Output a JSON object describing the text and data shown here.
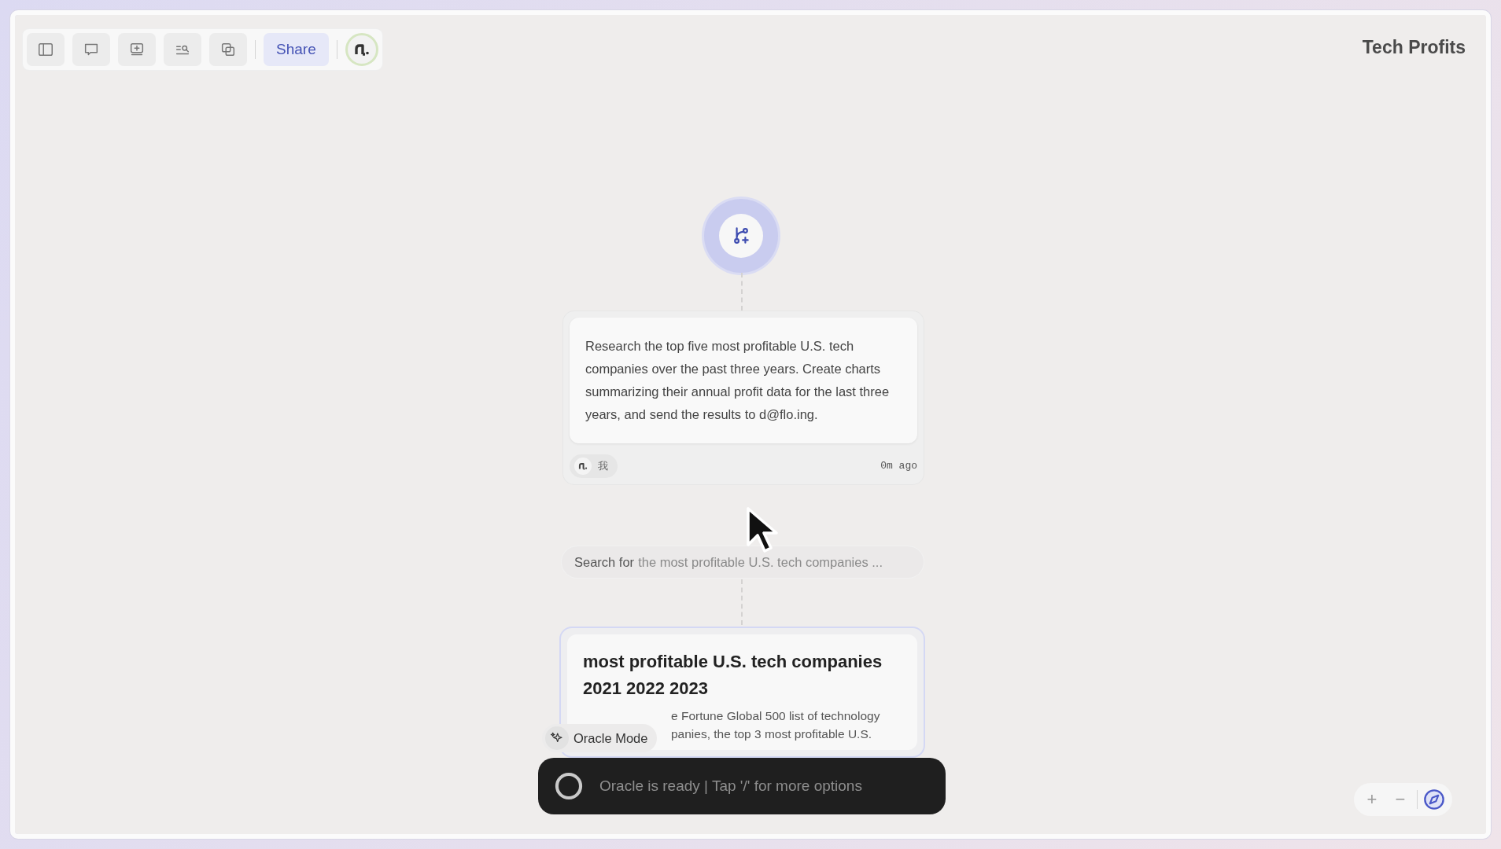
{
  "title": "Tech Profits",
  "toolbar": {
    "share": "Share"
  },
  "prompt": {
    "text": "Research the top five most profitable U.S. tech companies over the past three years. Create charts summarizing their annual profit data for the last three years, and send the results to d@flo.ing.",
    "author": "我",
    "time": "0m ago"
  },
  "search_step": {
    "label": "Search for",
    "query": "the most profitable U.S. tech companies ..."
  },
  "result": {
    "title": "most profitable U.S. tech companies 2021 2022 2023",
    "lines": [
      "e Fortune Global 500 list of technology",
      "panies, the top 3 most profitable U.S."
    ]
  },
  "oracle_mode": {
    "label": "Oracle Mode"
  },
  "command_bar": {
    "placeholder": "Oracle is ready | Tap '/' for more options"
  },
  "zoom_controls": {
    "zoom_in": "+",
    "zoom_out": "−"
  }
}
